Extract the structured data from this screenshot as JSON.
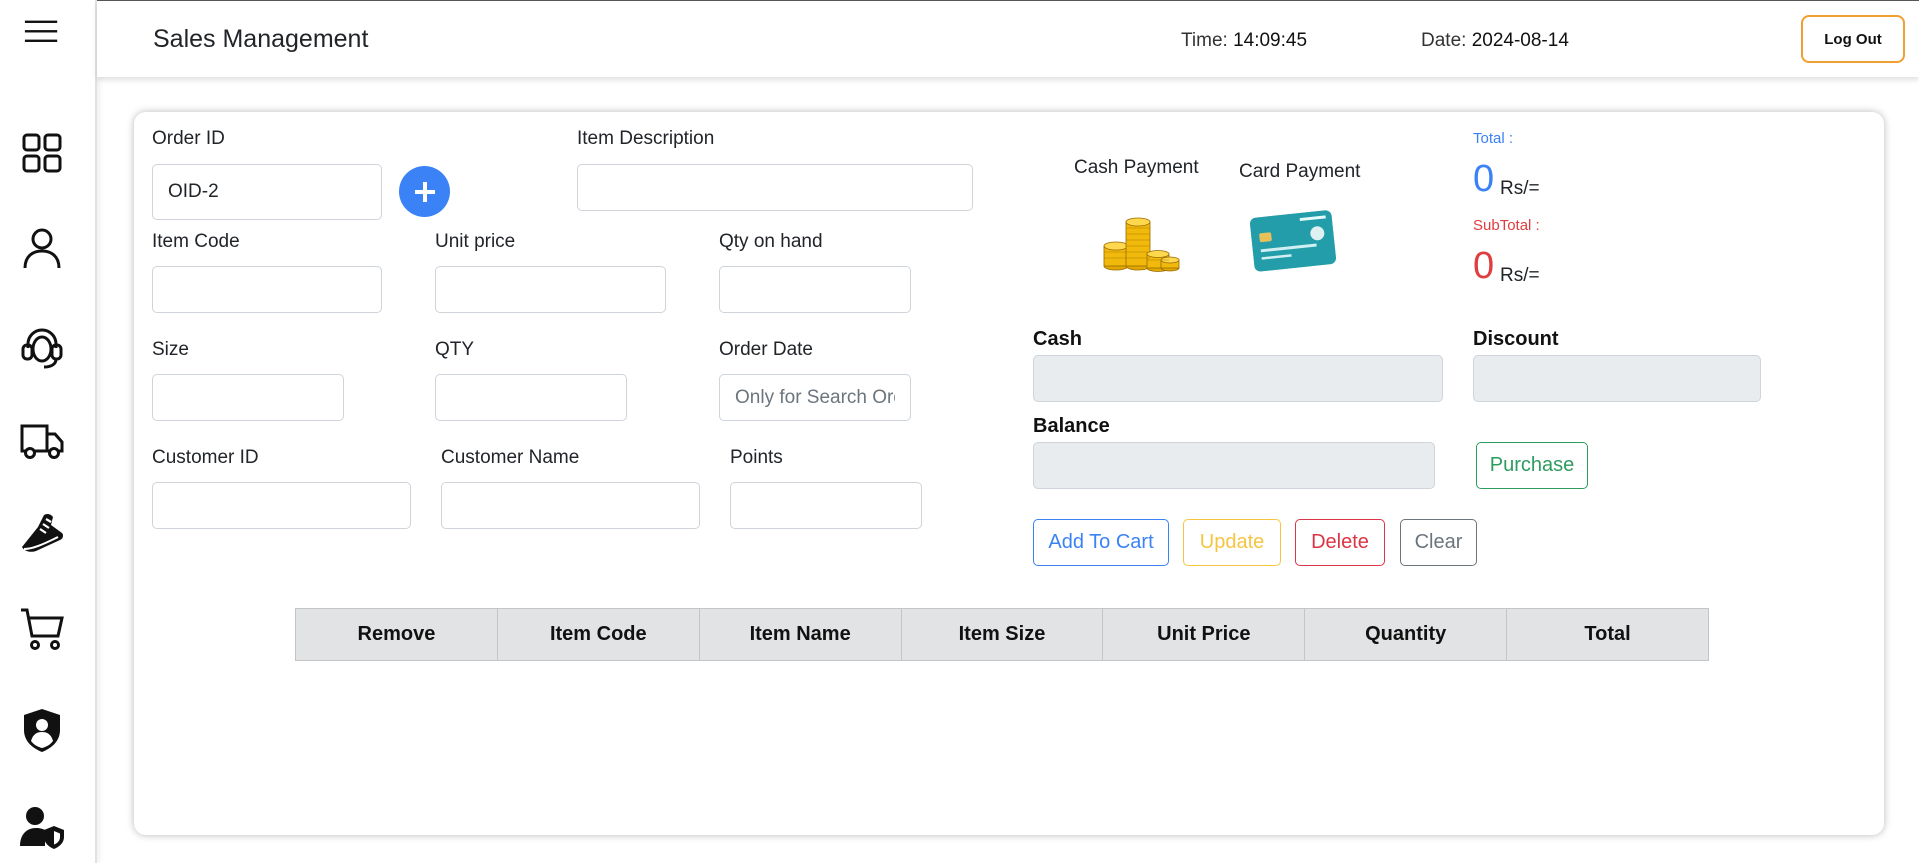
{
  "header": {
    "title": "Sales Management",
    "time_label": "Time:",
    "time_value": "14:09:45",
    "date_label": "Date:",
    "date_value": "2024-08-14",
    "logout_label": "Log Out"
  },
  "sidebar": {
    "items": [
      {
        "icon": "dashboard-grid-icon"
      },
      {
        "icon": "user-icon"
      },
      {
        "icon": "headset-support-icon"
      },
      {
        "icon": "delivery-truck-icon"
      },
      {
        "icon": "shoe-icon"
      },
      {
        "icon": "shopping-cart-icon"
      },
      {
        "icon": "shield-user-icon"
      },
      {
        "icon": "user-shield-icon"
      }
    ]
  },
  "form": {
    "order_id_label": "Order ID",
    "order_id_value": "OID-2",
    "item_description_label": "Item Description",
    "item_code_label": "Item Code",
    "unit_price_label": "Unit price",
    "qty_on_hand_label": "Qty on hand",
    "size_label": "Size",
    "qty_label": "QTY",
    "order_date_label": "Order Date",
    "order_date_placeholder": "Only for Search Order",
    "customer_id_label": "Customer ID",
    "customer_name_label": "Customer Name",
    "points_label": "Points"
  },
  "payment": {
    "cash_payment_label": "Cash Payment",
    "card_payment_label": "Card Payment",
    "total_label": "Total :",
    "total_value": "0",
    "subtotal_label": "SubTotal :",
    "subtotal_value": "0",
    "currency_unit": "Rs/=",
    "cash_label": "Cash",
    "discount_label": "Discount",
    "balance_label": "Balance",
    "purchase_label": "Purchase"
  },
  "actions": {
    "add_to_cart": "Add To Cart",
    "update": "Update",
    "delete": "Delete",
    "clear": "Clear"
  },
  "cart_table": {
    "columns": [
      "Remove",
      "Item Code",
      "Item Name",
      "Item Size",
      "Unit Price",
      "Quantity",
      "Total"
    ],
    "rows": []
  },
  "colors": {
    "primary": "#3b82f6",
    "success": "#2e9b5f",
    "warning": "#f5c542",
    "danger": "#dc3545",
    "secondary": "#6c757d",
    "logout_border": "#f0a030"
  }
}
